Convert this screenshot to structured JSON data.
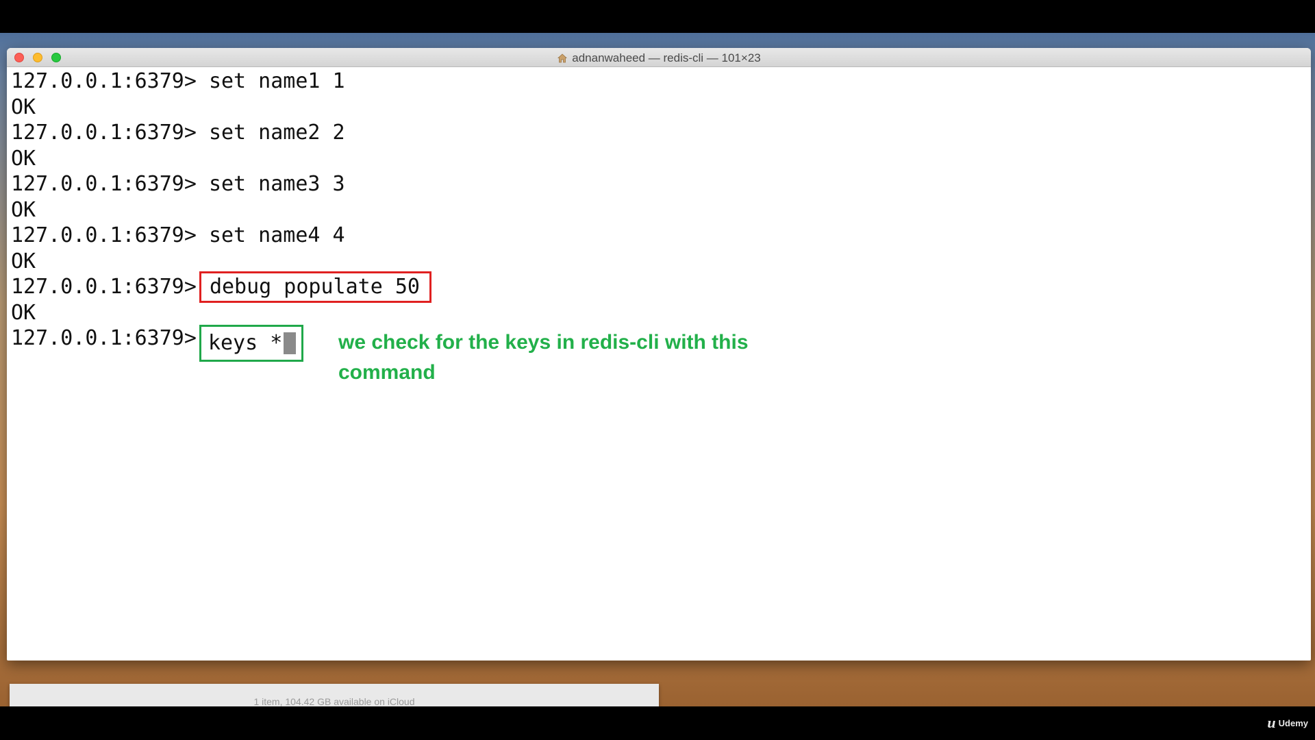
{
  "window": {
    "title": "adnanwaheed — redis-cli — 101×23"
  },
  "terminal": {
    "lines": [
      {
        "prompt": "127.0.0.1:6379>",
        "command": "set name1 1"
      },
      {
        "output": "OK"
      },
      {
        "prompt": "127.0.0.1:6379>",
        "command": "set name2 2"
      },
      {
        "output": "OK"
      },
      {
        "prompt": "127.0.0.1:6379>",
        "command": "set name3 3"
      },
      {
        "output": "OK"
      },
      {
        "prompt": "127.0.0.1:6379>",
        "command": "set name4 4"
      },
      {
        "output": "OK"
      },
      {
        "prompt": "127.0.0.1:6379>",
        "command": "debug populate 50"
      },
      {
        "output": "OK"
      },
      {
        "prompt": "127.0.0.1:6379>",
        "command": "keys *"
      }
    ]
  },
  "annotation": {
    "text": "we check for the keys in redis-cli with this command",
    "color": "#22b04a"
  },
  "highlight_colors": {
    "debug_box": "#e02020",
    "keys_box": "#20a84a"
  },
  "finder": {
    "status": "1 item, 104.42 GB available on iCloud"
  },
  "watermark": {
    "brand": "Udemy"
  }
}
